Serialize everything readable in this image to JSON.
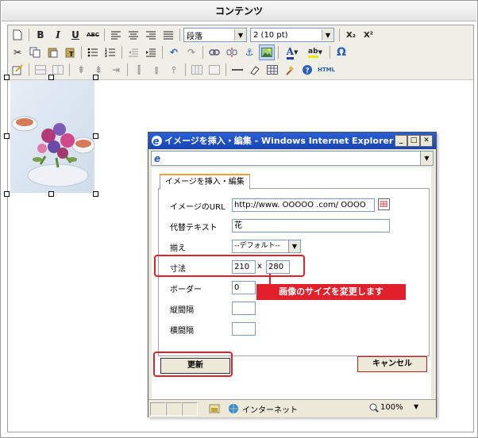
{
  "panel_title": "コンテンツ",
  "toolbar": {
    "format_value": "段落",
    "size_value": "2 (10 pt)",
    "html_label": "HTML",
    "underline_label": "U",
    "bold_label": "B",
    "italic_label": "I",
    "strike_label": "ABC",
    "subscript_label": "X₂",
    "superscript_label": "X²",
    "font_color_label": "A",
    "highlight_label": "ab",
    "omega_label": "Ω"
  },
  "dialog": {
    "title": "イメージを挿入・編集 - Windows Internet Explorer",
    "tab_label": "イメージを挿入・編集",
    "fields": {
      "url_label": "イメージのURL",
      "url_value": "http://www. OOOOO .com/ OOOO",
      "alt_label": "代替テキスト",
      "alt_value": "花",
      "align_label": "揃え",
      "align_value": "--デフォルト--",
      "size_label": "寸法",
      "width_value": "210",
      "size_sep": "x",
      "height_value": "280",
      "border_label": "ボーダー",
      "border_value": "0",
      "vspace_label": "縦間隔",
      "hspace_label": "横間隔"
    },
    "update_button": "更新",
    "cancel_button": "キャンセル",
    "status": {
      "zone": "インターネット",
      "zoom": "100%"
    }
  },
  "callout": "画像のサイズを変更します",
  "colors": {
    "accent_red": "#e2202c",
    "title_blue": "#1845b0"
  }
}
